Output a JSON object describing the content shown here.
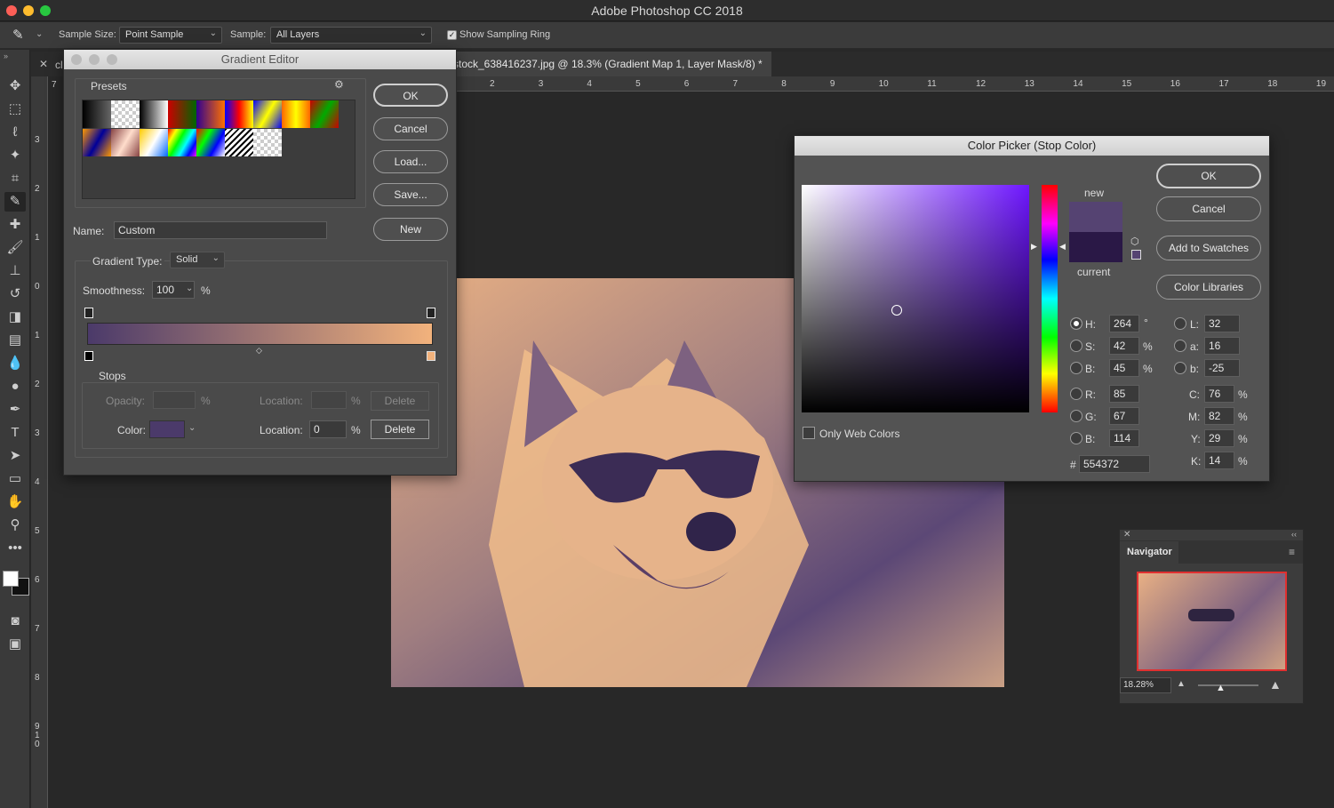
{
  "app": {
    "title": "Adobe Photoshop CC 2018"
  },
  "options": {
    "sample_size_label": "Sample Size:",
    "sample_size_value": "Point Sample",
    "sample_label": "Sample:",
    "sample_value": "All Layers",
    "show_ring_label": "Show Sampling Ring",
    "show_ring_checked": true
  },
  "document": {
    "tab_title": "stock_638416237.jpg @ 18.3% (Gradient Map 1, Layer Mask/8) *",
    "tab_prefix": "cl",
    "ruler_h": [
      "2",
      "3",
      "4",
      "5",
      "6",
      "7",
      "8",
      "9",
      "10",
      "11",
      "12",
      "13",
      "14",
      "15",
      "16",
      "17",
      "18",
      "19"
    ],
    "ruler_v": [
      "3",
      "2",
      "1",
      "0",
      "1",
      "2",
      "3",
      "4",
      "5",
      "6",
      "7",
      "8",
      "9",
      "1",
      "0"
    ],
    "ruler_h_first": "7"
  },
  "gradient_editor": {
    "title": "Gradient Editor",
    "presets_label": "Presets",
    "ok": "OK",
    "cancel": "Cancel",
    "load": "Load...",
    "save": "Save...",
    "name_label": "Name:",
    "name_value": "Custom",
    "new": "New",
    "type_label": "Gradient Type:",
    "type_value": "Solid",
    "smooth_label": "Smoothness:",
    "smooth_value": "100",
    "smooth_unit": "%",
    "stops_label": "Stops",
    "opacity_label": "Opacity:",
    "opacity_unit": "%",
    "location_label": "Location:",
    "location_unit": "%",
    "delete": "Delete",
    "color_label": "Color:",
    "location_value": "0",
    "gradient_start": "#4b3a6a",
    "gradient_end": "#f2b27c"
  },
  "color_picker": {
    "title": "Color Picker (Stop Color)",
    "ok": "OK",
    "cancel": "Cancel",
    "add_swatches": "Add to Swatches",
    "color_libraries": "Color Libraries",
    "new_label": "new",
    "current_label": "current",
    "new_color": "#554372",
    "current_color": "#2a1846",
    "only_web": "Only Web Colors",
    "hsb": [
      {
        "label": "H:",
        "value": "264",
        "unit": "°"
      },
      {
        "label": "S:",
        "value": "42",
        "unit": "%"
      },
      {
        "label": "B:",
        "value": "45",
        "unit": "%"
      }
    ],
    "rgb": [
      {
        "label": "R:",
        "value": "85"
      },
      {
        "label": "G:",
        "value": "67"
      },
      {
        "label": "B:",
        "value": "114"
      }
    ],
    "lab": [
      {
        "label": "L:",
        "value": "32"
      },
      {
        "label": "a:",
        "value": "16"
      },
      {
        "label": "b:",
        "value": "-25"
      }
    ],
    "cmyk": [
      {
        "label": "C:",
        "value": "76",
        "unit": "%"
      },
      {
        "label": "M:",
        "value": "82",
        "unit": "%"
      },
      {
        "label": "Y:",
        "value": "29",
        "unit": "%"
      },
      {
        "label": "K:",
        "value": "14",
        "unit": "%"
      }
    ],
    "hex_label": "#",
    "hex_value": "554372"
  },
  "navigator": {
    "title": "Navigator",
    "zoom": "18.28%"
  }
}
